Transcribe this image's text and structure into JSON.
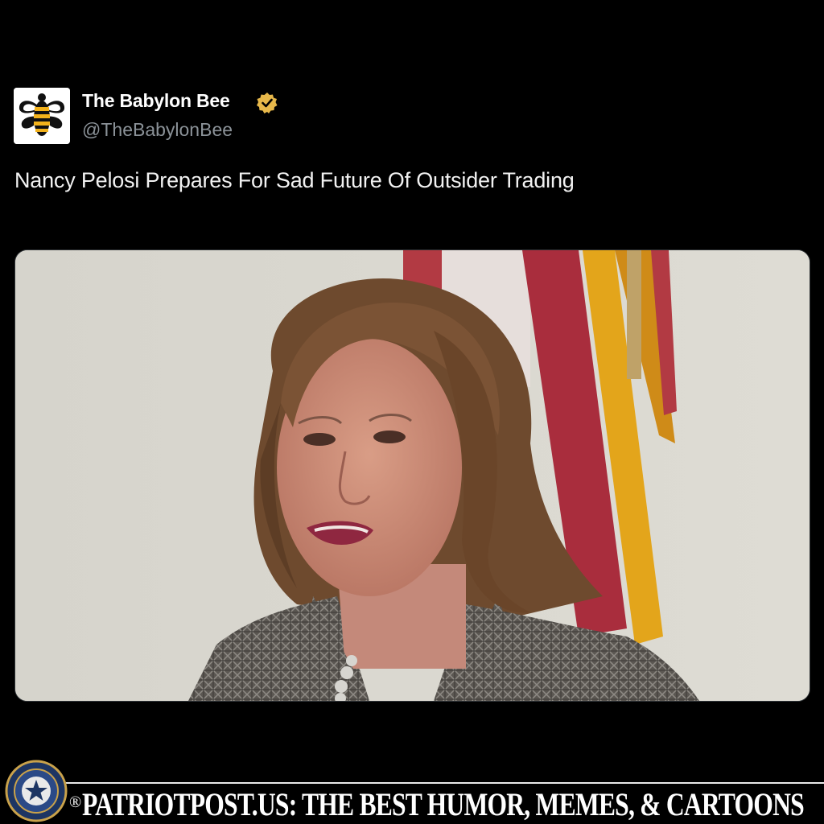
{
  "tweet": {
    "display_name": "The Babylon Bee",
    "verified": true,
    "verified_icon": "verified-badge-icon",
    "handle": "@TheBabylonBee",
    "text": "Nancy Pelosi Prepares For Sad Future Of Outsider Trading",
    "avatar_icon": "babylon-bee-logo-icon"
  },
  "media": {
    "description_icon": "photo-woman-with-flag"
  },
  "footer": {
    "registered_mark": "®",
    "text": "PATRIOTPOST.US: THE BEST HUMOR, MEMES, & CARTOONS",
    "seal_icon": "patriot-post-seal-icon"
  },
  "colors": {
    "background": "#000000",
    "text_primary": "#ffffff",
    "text_secondary": "#8b9298",
    "verified_gold": "#e7b84a",
    "bee_yellow": "#f3b21b"
  }
}
